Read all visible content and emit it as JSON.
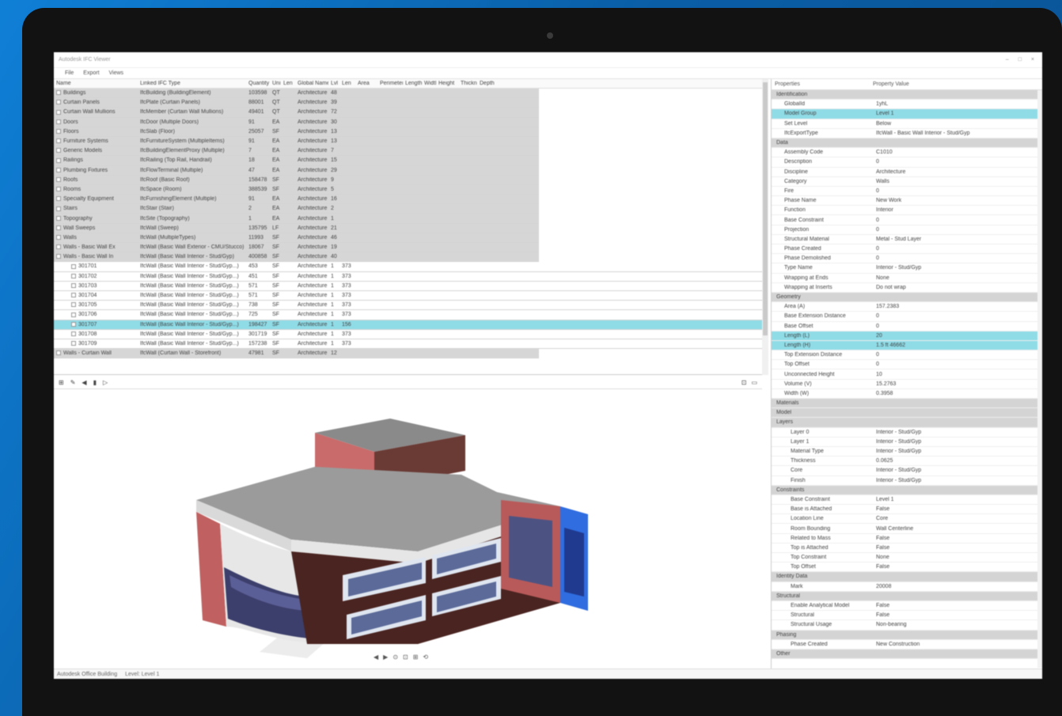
{
  "window": {
    "title": "Autodesk IFC Viewer",
    "controls": [
      "–",
      "□",
      "×"
    ]
  },
  "menu": [
    "File",
    "Export",
    "Views"
  ],
  "grid": {
    "headers": [
      "Name",
      "Linked IFC Type",
      "Quantity",
      "Uni",
      "Len",
      "Global Name",
      "Lvl",
      "Len",
      "Area",
      "Perimeter",
      "Length",
      "Width",
      "Height",
      "Thickness",
      "Depth"
    ],
    "groups": [
      {
        "name": "Buildings",
        "type": "IfcBuilding (BuildingElement)",
        "qty": "103598",
        "u": "QT",
        "g": "Architecture",
        "l": "48"
      },
      {
        "name": "Curtain Panels",
        "type": "IfcPlate (Curtain Panels)",
        "qty": "88001",
        "u": "QT",
        "g": "Architecture",
        "l": "39"
      },
      {
        "name": "Curtain Wall Mullions",
        "type": "IfcMember (Curtain Wall Mullions)",
        "qty": "49401",
        "u": "QT",
        "g": "Architecture",
        "l": "72"
      },
      {
        "name": "Doors",
        "type": "IfcDoor (Multiple Doors)",
        "qty": "91",
        "u": "EA",
        "g": "Architecture",
        "l": "30"
      },
      {
        "name": "Floors",
        "type": "IfcSlab (Floor)",
        "qty": "25057",
        "u": "SF",
        "g": "Architecture",
        "l": "13"
      },
      {
        "name": "Furniture Systems",
        "type": "IfcFurnitureSystem (MultipleItems)",
        "qty": "91",
        "u": "EA",
        "g": "Architecture",
        "l": "13"
      },
      {
        "name": "Generic Models",
        "type": "IfcBuildingElementProxy (Multiple)",
        "qty": "7",
        "u": "EA",
        "g": "Architecture",
        "l": "7"
      },
      {
        "name": "Railings",
        "type": "IfcRailing (Top Rail, Handrail)",
        "qty": "18",
        "u": "EA",
        "g": "Architecture",
        "l": "15"
      },
      {
        "name": "Plumbing Fixtures",
        "type": "IfcFlowTerminal (Multiple)",
        "qty": "47",
        "u": "EA",
        "g": "Architecture",
        "l": "29"
      },
      {
        "name": "Roofs",
        "type": "IfcRoof (Basic Roof)",
        "qty": "158478",
        "u": "SF",
        "g": "Architecture",
        "l": "9"
      },
      {
        "name": "Rooms",
        "type": "IfcSpace (Room)",
        "qty": "388539",
        "u": "SF",
        "g": "Architecture",
        "l": "5"
      },
      {
        "name": "Specialty Equipment",
        "type": "IfcFurnishingElement (Multiple)",
        "qty": "91",
        "u": "EA",
        "g": "Architecture",
        "l": "16"
      },
      {
        "name": "Stairs",
        "type": "IfcStair (Stair)",
        "qty": "2",
        "u": "EA",
        "g": "Architecture",
        "l": "2"
      },
      {
        "name": "Topography",
        "type": "IfcSite (Topography)",
        "qty": "1",
        "u": "EA",
        "g": "Architecture",
        "l": "1"
      },
      {
        "name": "Wall Sweeps",
        "type": "IfcWall (Sweep)",
        "qty": "135795",
        "u": "LF",
        "g": "Architecture",
        "l": "21"
      },
      {
        "name": "Walls",
        "type": "IfcWall (MultipleTypes)",
        "qty": "11993",
        "u": "SF",
        "g": "Architecture",
        "l": "46"
      },
      {
        "name": "Walls - Basic Wall Ex",
        "type": "IfcWall (Basic Wall Exterior - CMU/Stucco)",
        "qty": "18067",
        "u": "SF",
        "g": "Architecture",
        "l": "19"
      },
      {
        "name": "Walls - Basic Wall In",
        "type": "IfcWall (Basic Wall Interior - Stud/Gyp)",
        "qty": "400858",
        "u": "SF",
        "g": "Architecture",
        "l": "40"
      }
    ],
    "items": [
      {
        "name": "301701",
        "type": "IfcWall (Basic Wall Interior - Stud/Gyp...)",
        "qty": "453",
        "u": "SF",
        "g": "Architecture",
        "l": "1",
        "a": "373"
      },
      {
        "name": "301702",
        "type": "IfcWall (Basic Wall Interior - Stud/Gyp...)",
        "qty": "451",
        "u": "SF",
        "g": "Architecture",
        "l": "1",
        "a": "373"
      },
      {
        "name": "301703",
        "type": "IfcWall (Basic Wall Interior - Stud/Gyp...)",
        "qty": "571",
        "u": "SF",
        "g": "Architecture",
        "l": "1",
        "a": "373"
      },
      {
        "name": "301704",
        "type": "IfcWall (Basic Wall Interior - Stud/Gyp...)",
        "qty": "571",
        "u": "SF",
        "g": "Architecture",
        "l": "1",
        "a": "373"
      },
      {
        "name": "301705",
        "type": "IfcWall (Basic Wall Interior - Stud/Gyp...)",
        "qty": "738",
        "u": "SF",
        "g": "Architecture",
        "l": "1",
        "a": "373"
      },
      {
        "name": "301706",
        "type": "IfcWall (Basic Wall Interior - Stud/Gyp...)",
        "qty": "725",
        "u": "SF",
        "g": "Architecture",
        "l": "1",
        "a": "373"
      },
      {
        "name": "301707",
        "type": "IfcWall (Basic Wall Interior - Stud/Gyp...)",
        "qty": "198427",
        "u": "SF",
        "g": "Architecture",
        "l": "1",
        "a": "156",
        "sel": true
      },
      {
        "name": "301708",
        "type": "IfcWall (Basic Wall Interior - Stud/Gyp...)",
        "qty": "301719",
        "u": "SF",
        "g": "Architecture",
        "l": "1",
        "a": "373"
      },
      {
        "name": "301709",
        "type": "IfcWall (Basic Wall Interior - Stud/Gyp...)",
        "qty": "157238",
        "u": "SF",
        "g": "Architecture",
        "l": "1",
        "a": "373"
      }
    ],
    "last": {
      "name": "Walls - Curtain Wall",
      "type": "IfcWall (Curtain Wall - Storefront)",
      "qty": "47981",
      "u": "SF",
      "g": "Architecture",
      "l": "12"
    }
  },
  "viewer_toolbar": [
    "⊞",
    "✎",
    "◀",
    "▮",
    "▷"
  ],
  "viewer_nav": [
    "◀",
    "▶",
    "⊙",
    "⊡",
    "⊞",
    "⟲"
  ],
  "properties": {
    "headers": [
      "Properties",
      "Property Value"
    ],
    "rows": [
      {
        "kind": "cat",
        "name": "Identification",
        "value": ""
      },
      {
        "kind": "item",
        "name": "GlobalId",
        "value": "1yhL"
      },
      {
        "kind": "sel",
        "name": "Model Group",
        "value": "Level 1"
      },
      {
        "kind": "item",
        "name": "Set Level",
        "value": "Below"
      },
      {
        "kind": "item",
        "name": "IfcExportType",
        "value": "IfcWall - Basic Wall Interior - Stud/Gyp"
      },
      {
        "kind": "cat",
        "name": "Data",
        "value": ""
      },
      {
        "kind": "item",
        "name": "Assembly Code",
        "value": "C1010"
      },
      {
        "kind": "item",
        "name": "Description",
        "value": "0"
      },
      {
        "kind": "item",
        "name": "Discipline",
        "value": "Architecture"
      },
      {
        "kind": "item",
        "name": "Category",
        "value": "Walls"
      },
      {
        "kind": "item",
        "name": "Fire",
        "value": "0"
      },
      {
        "kind": "item",
        "name": "Phase Name",
        "value": "New Work"
      },
      {
        "kind": "item",
        "name": "Function",
        "value": "Interior"
      },
      {
        "kind": "item",
        "name": "Base Constraint",
        "value": "0"
      },
      {
        "kind": "item",
        "name": "Projection",
        "value": "0"
      },
      {
        "kind": "item",
        "name": "Structural Material",
        "value": "Metal - Stud Layer"
      },
      {
        "kind": "item",
        "name": "Phase Created",
        "value": "0"
      },
      {
        "kind": "item",
        "name": "Phase Demolished",
        "value": "0"
      },
      {
        "kind": "item",
        "name": "Type Name",
        "value": "Interior - Stud/Gyp"
      },
      {
        "kind": "item",
        "name": "Wrapping at Ends",
        "value": "None"
      },
      {
        "kind": "item",
        "name": "Wrapping at Inserts",
        "value": "Do not wrap"
      },
      {
        "kind": "cat",
        "name": "Geometry",
        "value": ""
      },
      {
        "kind": "item",
        "name": "Area (A)",
        "value": "157.2383"
      },
      {
        "kind": "item",
        "name": "Base Extension Distance",
        "value": "0"
      },
      {
        "kind": "item",
        "name": "Base Offset",
        "value": "0"
      },
      {
        "kind": "sel",
        "name": "Length (L)",
        "value": "20"
      },
      {
        "kind": "sel",
        "name": "Length (H)",
        "value": "1.5 ft 46662"
      },
      {
        "kind": "item",
        "name": "Top Extension Distance",
        "value": "0"
      },
      {
        "kind": "item",
        "name": "Top Offset",
        "value": "0"
      },
      {
        "kind": "item",
        "name": "Unconnected Height",
        "value": "10"
      },
      {
        "kind": "item",
        "name": "Volume (V)",
        "value": "15.2763"
      },
      {
        "kind": "item",
        "name": "Width (W)",
        "value": "0.3958"
      },
      {
        "kind": "cat",
        "name": "Materials",
        "value": ""
      },
      {
        "kind": "cat",
        "name": "Model",
        "value": ""
      },
      {
        "kind": "cat",
        "name": "Layers",
        "value": ""
      },
      {
        "kind": "sub",
        "name": "Layer 0",
        "value": "Interior - Stud/Gyp"
      },
      {
        "kind": "sub",
        "name": "Layer 1",
        "value": "Interior - Stud/Gyp"
      },
      {
        "kind": "sub",
        "name": "Material Type",
        "value": "Interior - Stud/Gyp"
      },
      {
        "kind": "sub",
        "name": "Thickness",
        "value": "0.0625"
      },
      {
        "kind": "sub",
        "name": "Core",
        "value": "Interior - Stud/Gyp"
      },
      {
        "kind": "sub",
        "name": "Finish",
        "value": "Interior - Stud/Gyp"
      },
      {
        "kind": "cat",
        "name": "Constraints",
        "value": ""
      },
      {
        "kind": "sub",
        "name": "Base Constraint",
        "value": "Level 1"
      },
      {
        "kind": "sub",
        "name": "Base is Attached",
        "value": "False"
      },
      {
        "kind": "sub",
        "name": "Location Line",
        "value": "Core"
      },
      {
        "kind": "sub",
        "name": "Room Bounding",
        "value": "Wall Centerline"
      },
      {
        "kind": "sub",
        "name": "Related to Mass",
        "value": "False"
      },
      {
        "kind": "sub",
        "name": "Top is Attached",
        "value": "False"
      },
      {
        "kind": "sub",
        "name": "Top Constraint",
        "value": "None"
      },
      {
        "kind": "sub",
        "name": "Top Offset",
        "value": "False"
      },
      {
        "kind": "cat",
        "name": "Identity Data",
        "value": ""
      },
      {
        "kind": "sub",
        "name": "Mark",
        "value": "20008"
      },
      {
        "kind": "cat",
        "name": "Structural",
        "value": ""
      },
      {
        "kind": "sub",
        "name": "Enable Analytical Model",
        "value": "False"
      },
      {
        "kind": "sub",
        "name": "Structural",
        "value": "False"
      },
      {
        "kind": "sub",
        "name": "Structural Usage",
        "value": "Non-bearing"
      },
      {
        "kind": "cat",
        "name": "Phasing",
        "value": ""
      },
      {
        "kind": "sub",
        "name": "Phase Created",
        "value": "New Construction"
      },
      {
        "kind": "cat",
        "name": "Other",
        "value": ""
      }
    ]
  },
  "status": {
    "text": "Autodesk Office Building",
    "sub": "Level: Level 1"
  }
}
